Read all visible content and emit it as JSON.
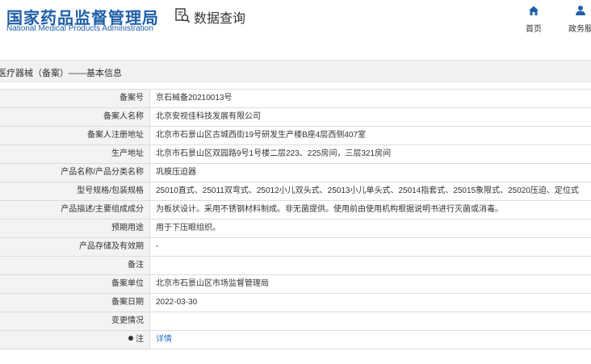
{
  "header": {
    "logo_cn": "国家药品监督管理局",
    "logo_en": "National Medical Products Administration",
    "query_title": "数据查询",
    "query_icon": "search-document-icon",
    "nav": [
      {
        "label": "首页",
        "icon": "home-icon"
      },
      {
        "label": "政务服",
        "icon": "user-icon"
      }
    ]
  },
  "section": {
    "title": "医疗器械（备案）——基本信息"
  },
  "rows": [
    {
      "label": "备案号",
      "value": "京石械备20210013号"
    },
    {
      "label": "备案人名称",
      "value": "北京安视佳科技发展有限公司"
    },
    {
      "label": "备案人注册地址",
      "value": "北京市石景山区古城西街19号研发生产楼B座4层西侧407室"
    },
    {
      "label": "生产地址",
      "value": "北京市石景山区双园路9号1号楼二层223、225房间，三层321房间"
    },
    {
      "label": "产品名称/产品分类名称",
      "value": "巩膜压迫器"
    },
    {
      "label": "型号规格/包装规格",
      "value": "25010直式、25011双弯式、25012小儿双头式、25013小儿单头式、25014指套式、25015象限式、25020压迫、定位式"
    },
    {
      "label": "产品描述/主要组成成分",
      "value": "为板状设计。采用不锈钢材料制成。非无菌提供。使用前由使用机构根据说明书进行灭菌或消毒。"
    },
    {
      "label": "预期用途",
      "value": "用于下压眼组织。"
    },
    {
      "label": "产品存储及有效期",
      "value": "-"
    },
    {
      "label": "备注",
      "value": ""
    },
    {
      "label": "备案单位",
      "value": "北京市石景山区市场监督管理局"
    },
    {
      "label": "备案日期",
      "value": "2022-03-30"
    },
    {
      "label": "变更情况",
      "value": ""
    }
  ],
  "note_row": {
    "label": "注",
    "value": "详情"
  },
  "colors": {
    "brand": "#1f5fa8",
    "link": "#2a6fc0",
    "label_bg": "#f3f3f3",
    "border": "#dcdcdc"
  }
}
